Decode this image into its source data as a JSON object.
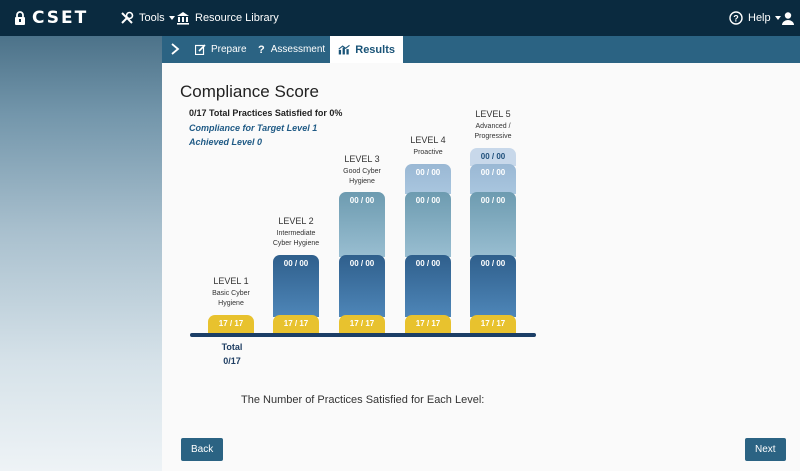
{
  "topbar": {
    "logo_text": "CSET",
    "tools_label": "Tools",
    "resource_label": "Resource Library",
    "help_label": "Help"
  },
  "subnav": {
    "tabs": [
      {
        "label": "Prepare"
      },
      {
        "label": "Assessment"
      },
      {
        "label": "Results"
      }
    ]
  },
  "main": {
    "title": "Compliance Score",
    "summary": "0/17 Total Practices Satisfied for 0%",
    "compliance": "Compliance for Target Level 1",
    "achieved": "Achieved Level 0",
    "total_label": "Total",
    "total_value": "0/17",
    "caption": "The Number of Practices Satisfied for Each Level:",
    "back_label": "Back",
    "next_label": "Next"
  },
  "levels": [
    {
      "name": "LEVEL 1",
      "desc1": "Basic Cyber",
      "desc2": "Hygiene"
    },
    {
      "name": "LEVEL 2",
      "desc1": "Intermediate",
      "desc2": "Cyber Hygiene"
    },
    {
      "name": "LEVEL 3",
      "desc1": "Good Cyber",
      "desc2": "Hygiene"
    },
    {
      "name": "LEVEL 4",
      "desc1": "Proactive",
      "desc2": ""
    },
    {
      "name": "LEVEL 5",
      "desc1": "Advanced /",
      "desc2": "Progressive"
    }
  ],
  "segments": {
    "l1": "17 / 17",
    "l2": "00 / 00",
    "l3": "00 / 00",
    "l4": "00 / 00",
    "l5": "00 / 00"
  },
  "colors": {
    "topbar": "#0a2a3f",
    "subnav": "#2b6383",
    "gold": "#e8c22e",
    "blue": "#2f5f8c"
  }
}
